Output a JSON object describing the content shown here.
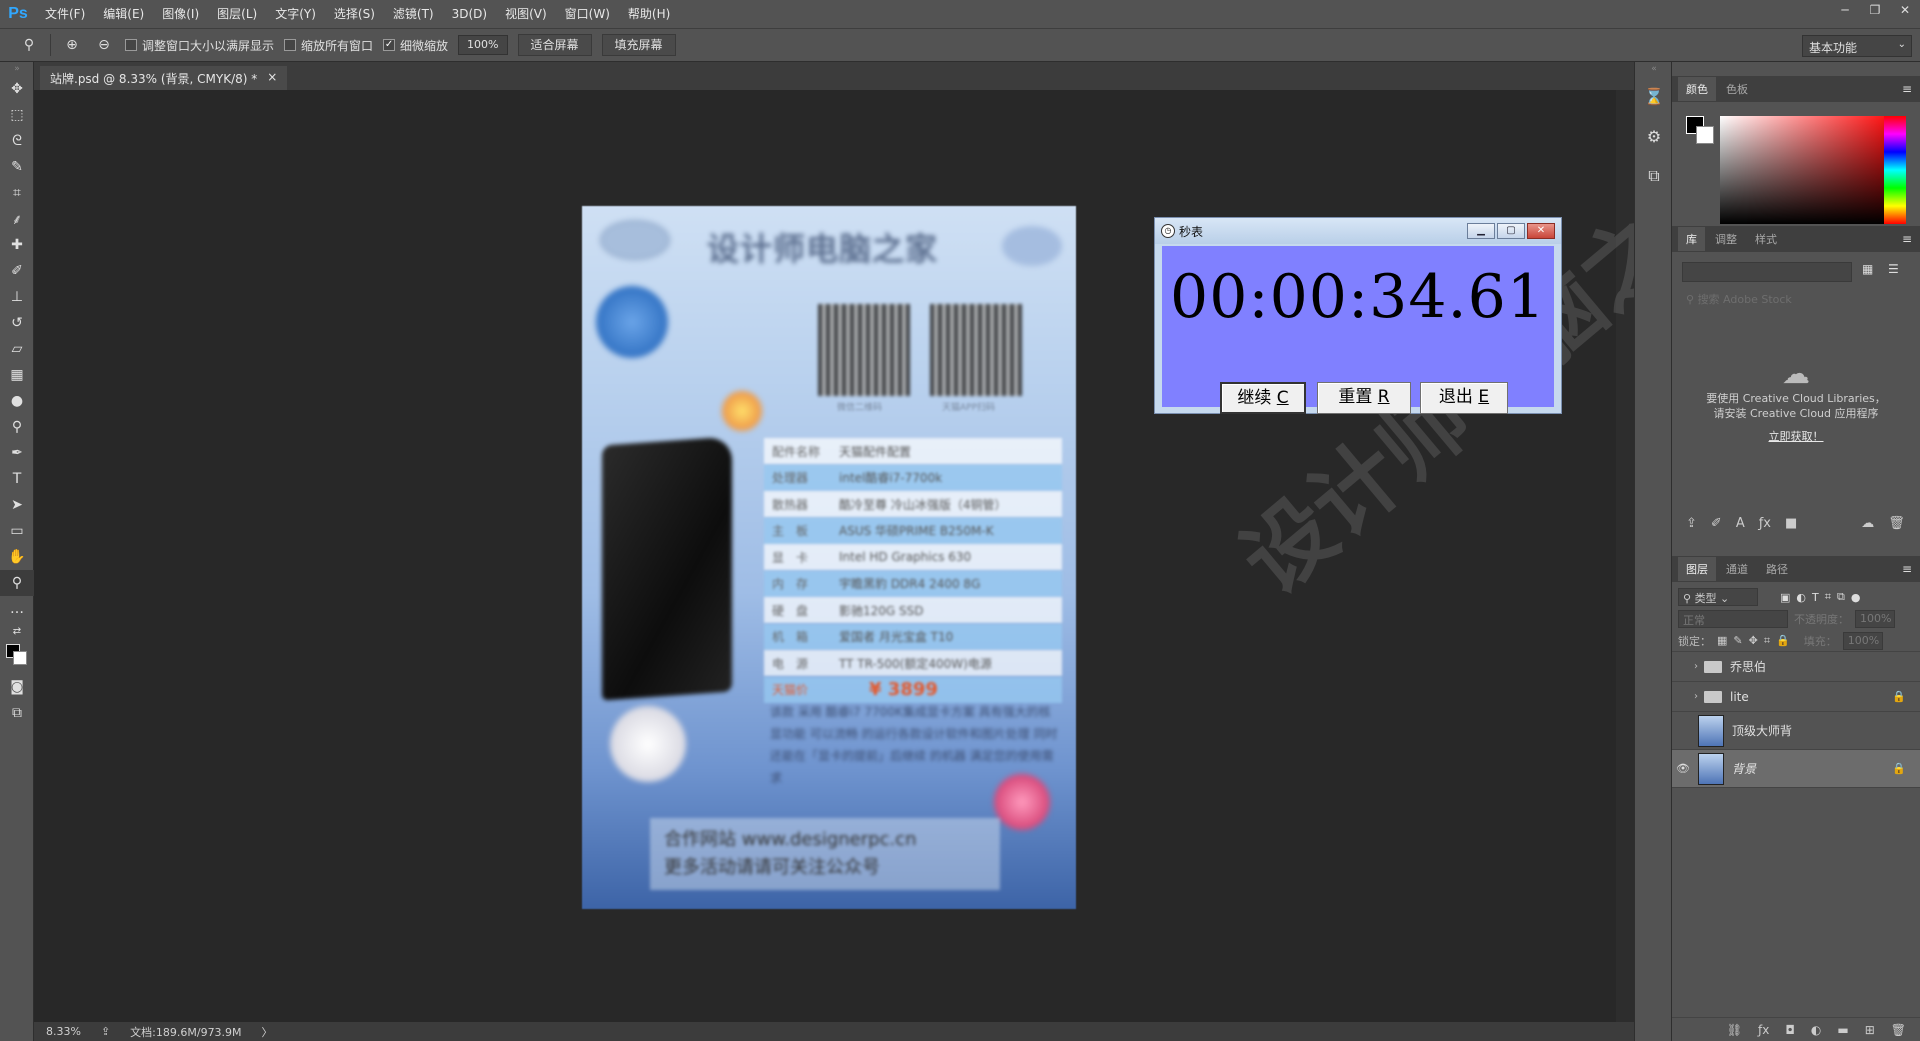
{
  "app": {
    "logo": "Ps"
  },
  "menu": [
    "文件(F)",
    "编辑(E)",
    "图像(I)",
    "图层(L)",
    "文字(Y)",
    "选择(S)",
    "滤镜(T)",
    "3D(D)",
    "视图(V)",
    "窗口(W)",
    "帮助(H)"
  ],
  "window_controls": {
    "minimize": "─",
    "restore": "❐",
    "close": "✕"
  },
  "options": {
    "resize_windows": "调整窗口大小以满屏显示",
    "zoom_all": "缩放所有窗口",
    "scrubby_zoom": "细微缩放",
    "zoom_value": "100%",
    "fit_screen": "适合屏幕",
    "fill_screen": "填充屏幕",
    "workspace": "基本功能",
    "resize_checked": false,
    "zoom_all_checked": false,
    "scrubby_checked": true
  },
  "document_tab": {
    "title": "站牌.psd @ 8.33% (背景, CMYK/8) *",
    "close": "×"
  },
  "poster": {
    "title": "设计师电脑之家",
    "qr1_caption": "微信二维码",
    "qr2_caption": "天猫APP扫码",
    "specs": [
      {
        "k": "配件名称",
        "v": "天猫配件配置"
      },
      {
        "k": "处理器",
        "v": "intel酷睿i7-7700k"
      },
      {
        "k": "散热器",
        "v": "酷冷至尊 冷山冰强版（4铜管）"
      },
      {
        "k": "主　板",
        "v": "ASUS 华硕PRIME B250M-K"
      },
      {
        "k": "显　卡",
        "v": "Intel HD Graphics 630"
      },
      {
        "k": "内　存",
        "v": "宇瞻黑豹 DDR4 2400 8G"
      },
      {
        "k": "硬　盘",
        "v": "影驰120G SSD"
      },
      {
        "k": "机　箱",
        "v": "爱国者 月光宝盒 T10"
      },
      {
        "k": "电　源",
        "v": "TT TR-500(额定400W)电源"
      }
    ],
    "price_label": "天猫价",
    "price": "¥ 3899",
    "description": "该款 采用 酷睿i7 7700K集成显卡方案 具有强大的核显功能 可以流畅 的运行各款设计软件和图片处理 同时还能在「显卡的提前」后继续 的机器 满足您的使用需求",
    "footer_line1": "合作网站 www.designerpc.cn",
    "footer_line2": "更多活动请请可关注公众号"
  },
  "stopwatch": {
    "title": "秒表",
    "time": "00:00:34.61",
    "btn_continue": "继续",
    "btn_continue_key": "C",
    "btn_reset": "重置",
    "btn_reset_key": "R",
    "btn_exit": "退出",
    "btn_exit_key": "E"
  },
  "watermark": "设计师电脑之家",
  "status": {
    "zoom": "8.33%",
    "doc": "文档:189.6M/973.9M",
    "arrow": "〉"
  },
  "color_panel": {
    "tab_color": "颜色",
    "tab_swatches": "色板",
    "menu": "≡"
  },
  "library_panel": {
    "tab_library": "库",
    "tab_adjust": "调整",
    "tab_style": "样式",
    "search_placeholder": "搜索 Adobe Stock",
    "cc_line1": "要使用 Creative Cloud Libraries，",
    "cc_line2": "请安装 Creative Cloud 应用程序",
    "cc_link": "立即获取！"
  },
  "layers_panel": {
    "tab_layers": "图层",
    "tab_channels": "通道",
    "tab_paths": "路径",
    "kind_filter": "类型",
    "blend_mode": "正常",
    "opacity_label": "不透明度：",
    "opacity_value": "100%",
    "lock_label": "锁定：",
    "fill_label": "填充：",
    "fill_value": "100%",
    "layers": [
      {
        "name": "乔思伯",
        "type": "group",
        "visible": false,
        "locked": false
      },
      {
        "name": "lite",
        "type": "group",
        "visible": false,
        "locked": true
      },
      {
        "name": "顶级大师背",
        "type": "image",
        "visible": false,
        "locked": false
      },
      {
        "name": "背景",
        "type": "image",
        "visible": true,
        "locked": true,
        "selected": true
      }
    ]
  },
  "colors": {
    "accent": "#31a8ff",
    "stopwatch_bg": "#8080ff",
    "price": "#e35a2f"
  }
}
